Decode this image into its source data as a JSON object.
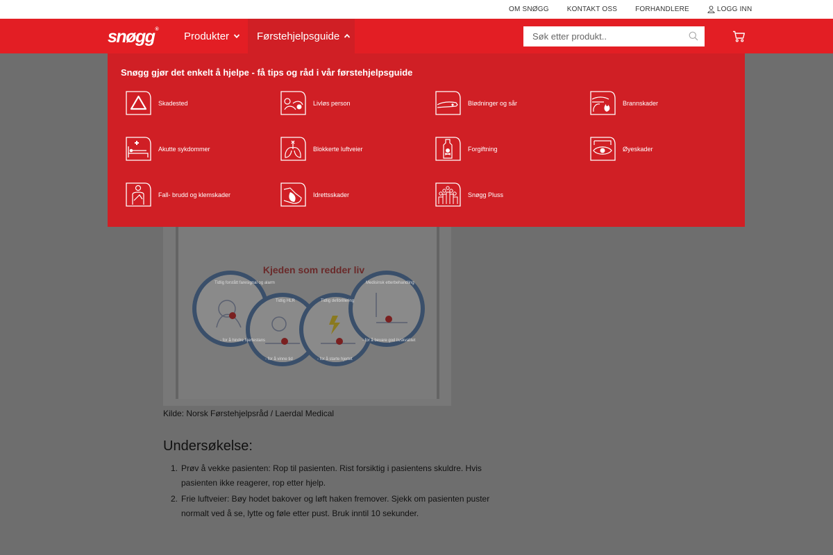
{
  "topbar": {
    "links": [
      "OM SNØGG",
      "KONTAKT OSS",
      "FORHANDLERE"
    ],
    "login": "LOGG INN"
  },
  "brand": {
    "name": "snøgg",
    "mark": "®"
  },
  "nav": {
    "products": "Produkter",
    "guide": "Førstehjelpsguide"
  },
  "search": {
    "placeholder": "Søk etter produkt.."
  },
  "dropdown": {
    "title": "Snøgg gjør det enkelt å hjelpe - få tips og råd i vår førstehjelpsguide",
    "items": [
      {
        "label": "Skadested",
        "icon": "warning-triangle-icon"
      },
      {
        "label": "Livløs person",
        "icon": "unconscious-person-icon"
      },
      {
        "label": "Blødninger og sår",
        "icon": "bleeding-arm-icon"
      },
      {
        "label": "Brannskader",
        "icon": "burn-hand-icon"
      },
      {
        "label": "Akutte sykdommer",
        "icon": "hospital-bed-icon"
      },
      {
        "label": "Blokkerte luftveier",
        "icon": "lungs-icon"
      },
      {
        "label": "Forgiftning",
        "icon": "poison-bottle-icon"
      },
      {
        "label": "Øyeskader",
        "icon": "eye-injury-icon"
      },
      {
        "label": "Fall- brudd og klemskader",
        "icon": "sling-arm-icon"
      },
      {
        "label": "Idrettsskader",
        "icon": "sports-injury-icon"
      },
      {
        "label": "Snøgg Pluss",
        "icon": "group-icon"
      }
    ]
  },
  "colors": {
    "brand_red": "#e31e24",
    "dropdown_red": "#d01f25"
  },
  "chain": {
    "title": "Kjeden som redder liv",
    "rings": [
      {
        "top": "Tidlig forstått faresignal og alarm",
        "bottom": "- for å hindre hjertestans"
      },
      {
        "top": "Tidlig HLR",
        "bottom": "- for å vinne tid"
      },
      {
        "top": "Tidlig defibrillering",
        "bottom": "- for å starte hjertet"
      },
      {
        "top": "Medisinsk etterbehandling",
        "bottom": "- for å bevare god livskvalitet"
      }
    ]
  },
  "content": {
    "caption": "Kilde: Norsk Førstehjelpsråd / Laerdal Medical",
    "section_title": "Undersøkelse:",
    "steps": [
      "Prøv å vekke pasienten: Rop til pasienten. Rist forsiktig i pasientens skuldre. Hvis pasienten ikke reagerer, rop etter hjelp.",
      "Frie luftveier: Bøy hodet bakover og løft haken fremover. Sjekk om pasienten puster normalt ved å se, lytte og føle etter pust. Bruk inntil 10 sekunder."
    ]
  }
}
